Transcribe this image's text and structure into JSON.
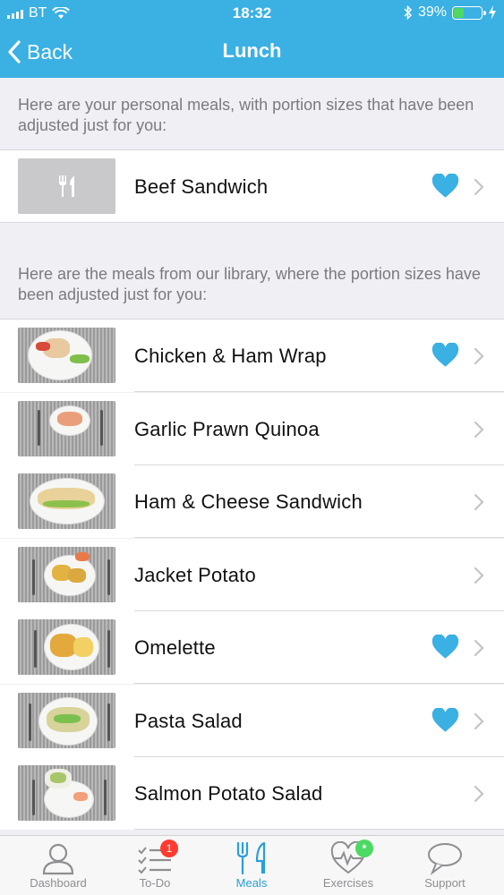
{
  "status_bar": {
    "carrier": "BT",
    "time": "18:32",
    "battery_percent": "39%",
    "battery_level": 0.39
  },
  "nav": {
    "back_label": "Back",
    "title": "Lunch"
  },
  "personal_section": {
    "header": "Here are your personal meals, with portion sizes that have been adjusted just for you:",
    "items": [
      {
        "name": "Beef Sandwich",
        "favourite": true,
        "thumb": "cutlery-icon-placeholder"
      }
    ]
  },
  "library_section": {
    "header": "Here are the meals from our library, where the portion sizes have been adjusted just for you:",
    "items": [
      {
        "name": "Chicken & Ham Wrap",
        "favourite": true
      },
      {
        "name": "Garlic Prawn Quinoa",
        "favourite": false
      },
      {
        "name": "Ham & Cheese Sandwich",
        "favourite": false
      },
      {
        "name": "Jacket Potato",
        "favourite": false
      },
      {
        "name": "Omelette",
        "favourite": true
      },
      {
        "name": "Pasta Salad",
        "favourite": true
      },
      {
        "name": "Salmon Potato Salad",
        "favourite": false
      }
    ]
  },
  "tab_bar": {
    "tabs": [
      {
        "label": "Dashboard",
        "icon": "person-icon",
        "active": false
      },
      {
        "label": "To-Do",
        "icon": "checklist-icon",
        "active": false,
        "badge": "1"
      },
      {
        "label": "Meals",
        "icon": "fork-knife-icon",
        "active": true
      },
      {
        "label": "Exercises",
        "icon": "heart-pulse-icon",
        "active": false,
        "badge": "*"
      },
      {
        "label": "Support",
        "icon": "speech-bubble-icon",
        "active": false
      }
    ]
  },
  "colors": {
    "header_blue": "#3ab0e3",
    "heart_blue": "#3ab0e3",
    "tab_active": "#2a9fd8",
    "badge_red": "#ff3b30",
    "badge_green": "#4cd964"
  }
}
